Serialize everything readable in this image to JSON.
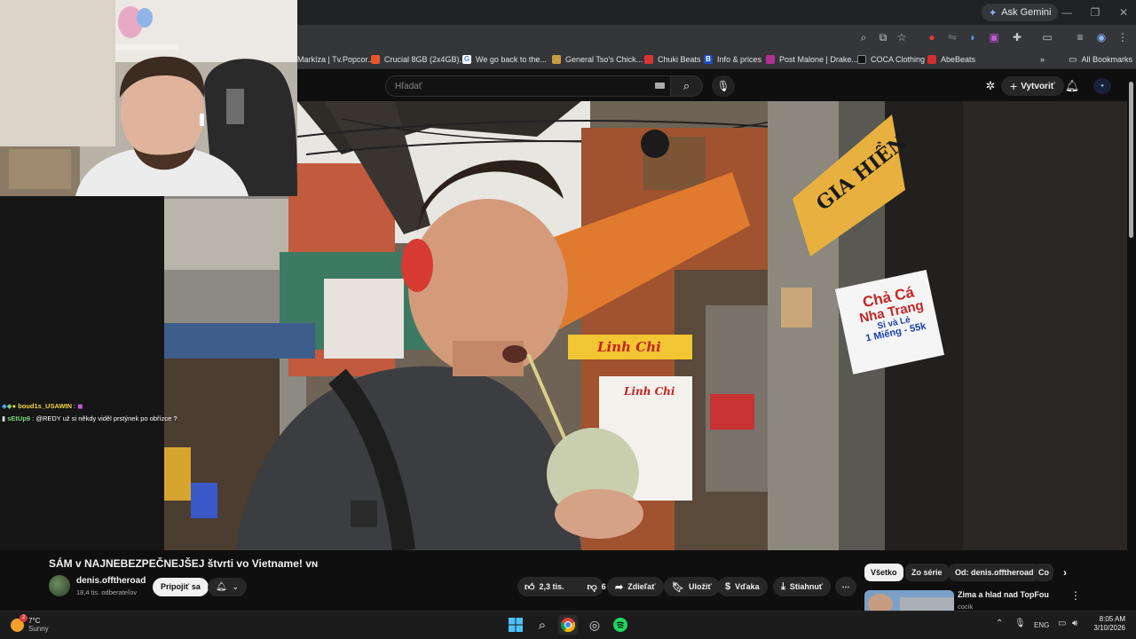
{
  "browser": {
    "ask_gemini": "Ask Gemini",
    "bookmarks": [
      {
        "label": "Markíza | Tv.Popcor...",
        "color": "#e23b3b"
      },
      {
        "label": "Crucial 8GB (2x4GB)...",
        "color": "#e8582b"
      },
      {
        "label": "We go back to the...",
        "color": "#4285f4"
      },
      {
        "label": "General Tso's Chick...",
        "color": "#c79a3f"
      },
      {
        "label": "Chuki Beats",
        "color": "#d93434"
      },
      {
        "label": "Info & prices",
        "color": "#1a4fbf"
      },
      {
        "label": "Post Malone | Drake...",
        "color": "#b03090"
      },
      {
        "label": "COCA Clothing",
        "color": "#222222"
      },
      {
        "label": "AbeBeats",
        "color": "#d42f2f"
      }
    ],
    "all_bookmarks": "All Bookmarks"
  },
  "youtube": {
    "search_placeholder": "Hľadať",
    "create_label": "Vytvoriť",
    "video_title": "SÁM v NAJNEBEZPEČNEJŠEJ štvrti vo Vietname! ᴠɴ",
    "channel_name": "denis.offtheroad",
    "channel_subs": "18,4 tis. odberateľov",
    "join_label": "Pripojiť sa",
    "likes": "2,3 tis.",
    "dislikes": "6",
    "share_label": "Zdieľať",
    "save_label": "Uložiť",
    "thanks_label": "Vďaka",
    "download_label": "Stiahnuť",
    "chips": [
      "Všetko",
      "Zo série",
      "Od: denis.offtheroad",
      "Co"
    ],
    "recommendation": {
      "title": "Zima a hlad nad TopFou",
      "channel": "cocik"
    }
  },
  "overlay": {
    "chat": [
      {
        "user": "boud1s_USAWIN",
        "message": "",
        "color": "#f5d442"
      },
      {
        "user": "sEtUp9",
        "message": "@REDY už si někdy viděl prstýnek po obřízce ?",
        "color": "#7bd67b"
      }
    ]
  },
  "video_signs": {
    "gia_hien": "GIA HIỀN",
    "cha_ca_line1": "Chả Cá",
    "cha_ca_line2": "Nha Trang",
    "si_le": "Sỉ và Lẻ",
    "price": "1 Miếng - 55k",
    "linh_chi": "Linh Chi"
  },
  "taskbar": {
    "temp": "7°C",
    "weather": "Sunny",
    "weather_badge": "2",
    "lang": "ENG",
    "time": "8:05 AM",
    "date": "3/10/2026"
  }
}
